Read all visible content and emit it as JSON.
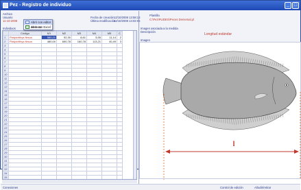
{
  "window": {
    "title": "Pez - Registro de individuo"
  },
  "header": {
    "archivo_label": "Archivo",
    "usuario_label": "Usuario",
    "usuario_value": "11-10-2008",
    "fecha_creacion_label": "Fecha de creación",
    "fecha_creacion_value": "12/10/2008 13:58:16",
    "ultima_mod_label": "Última modificación",
    "ultima_mod_value": "12/10/2008 14:02:05",
    "plantilla_label": "Plantilla",
    "plantilla_value": "C:\\Pez\\PLIDES\\Peces Demersal.pl",
    "individuos_label": "Individuos",
    "imagen_label": "Imagen asociada a la medida",
    "descripcion_label": "Descripción",
    "descripcion_value": "Longitud estándar",
    "imagen2_label": "Imagen"
  },
  "context_menu": {
    "items": [
      {
        "label": "Abrir con editor de texto"
      },
      {
        "label": "Abrir con Excel"
      }
    ]
  },
  "table": {
    "columns": [
      "",
      "Código",
      "M1",
      "M2",
      "M3",
      "M4",
      "M5",
      "C"
    ],
    "rows": [
      {
        "n": "1",
        "code": "Platyichthys flesus",
        "m1": "560,21",
        "m2": "92,30",
        "m3": "8,61",
        "m4": "5,55",
        "m5": "11,14",
        "c": "2"
      },
      {
        "n": "2",
        "code": "Platyichthys flesus",
        "m1": "480,00",
        "m2": "690,78",
        "m3": "160,78",
        "m4": "113,21",
        "m5": "40,49",
        "c": "3"
      },
      {
        "n": "3"
      },
      {
        "n": "4"
      },
      {
        "n": "5"
      },
      {
        "n": "6"
      },
      {
        "n": "7"
      },
      {
        "n": "8"
      },
      {
        "n": "9"
      },
      {
        "n": "10"
      },
      {
        "n": "11"
      },
      {
        "n": "12"
      },
      {
        "n": "13"
      },
      {
        "n": "14"
      },
      {
        "n": "15"
      },
      {
        "n": "16"
      },
      {
        "n": "17"
      },
      {
        "n": "18"
      },
      {
        "n": "19"
      },
      {
        "n": "20"
      },
      {
        "n": "21"
      },
      {
        "n": "22"
      },
      {
        "n": "23"
      },
      {
        "n": "24"
      },
      {
        "n": "25"
      },
      {
        "n": "26"
      },
      {
        "n": "27"
      },
      {
        "n": "28"
      },
      {
        "n": "29"
      },
      {
        "n": "30"
      },
      {
        "n": "31"
      },
      {
        "n": "32"
      },
      {
        "n": "33"
      },
      {
        "n": "34"
      },
      {
        "n": "35"
      }
    ]
  },
  "figure": {
    "measure_label": "l",
    "accent_color": "#c0392b",
    "measure_color": "#d35400"
  },
  "statusbar": {
    "left": "Conexiones",
    "right1": "Control de edición",
    "right2": "Añadir/retirar"
  },
  "colors": {
    "titlebar": "#1f49b5",
    "label": "#2a3a8a",
    "value": "#c0392b",
    "selection": "#3553b0"
  }
}
